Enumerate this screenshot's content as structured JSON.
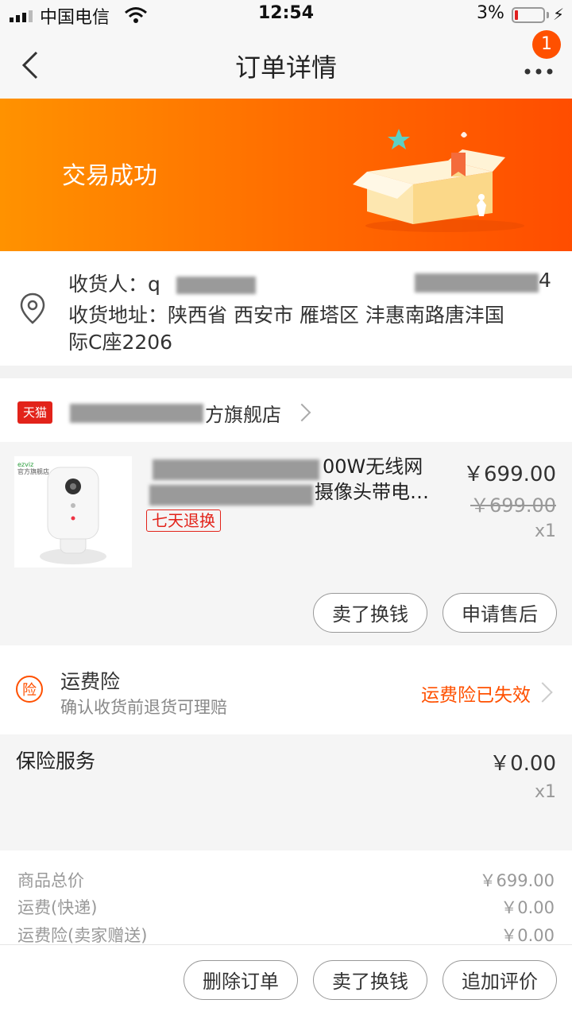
{
  "status_bar": {
    "carrier": "中国电信",
    "time": "12:54",
    "battery_percent": "3%",
    "battery_level": 0.03
  },
  "nav": {
    "title": "订单详情",
    "badge": "1"
  },
  "banner": {
    "status": "交易成功"
  },
  "address": {
    "recipient_label": "收货人：",
    "recipient_visible": "q",
    "phone_tail": "4",
    "address_label": "收货地址：",
    "address_line1": "陕西省 西安市 雁塔区 沣惠南路唐沣国",
    "address_line2": "际C座2206"
  },
  "shop": {
    "name_visible": "方旗舰店",
    "platform_badge": "天猫"
  },
  "product": {
    "title_line1_visible": "00W无线网",
    "title_line2_visible": "摄像头带电…",
    "return_tag": "七天退换",
    "price": "￥699.00",
    "original_price": "￥699.00",
    "quantity": "x1",
    "image_logo_line1": "ezviz",
    "image_logo_line2": "官方旗舰店"
  },
  "product_actions": {
    "sell_button": "卖了换钱",
    "after_sale_button": "申请售后"
  },
  "freight_insurance": {
    "icon_text": "险",
    "title": "运费险",
    "subtitle": "确认收货前退货可理赔",
    "status": "运费险已失效"
  },
  "insurance_service": {
    "title": "保险服务",
    "price": "￥0.00",
    "quantity": "x1"
  },
  "summary": {
    "rows": [
      {
        "label": "商品总价",
        "value": "￥699.00"
      },
      {
        "label": "运费(快递)",
        "value": "￥0.00"
      },
      {
        "label": "运费险(卖家赠送)",
        "value": "￥0.00"
      }
    ]
  },
  "bottom_actions": {
    "delete_button": "删除订单",
    "sell_button": "卖了换钱",
    "review_button": "追加评价"
  },
  "colors": {
    "accent": "#ff5000",
    "banner_start": "#ff9200",
    "banner_end": "#ff4d00",
    "tmall_red": "#e2231a"
  }
}
